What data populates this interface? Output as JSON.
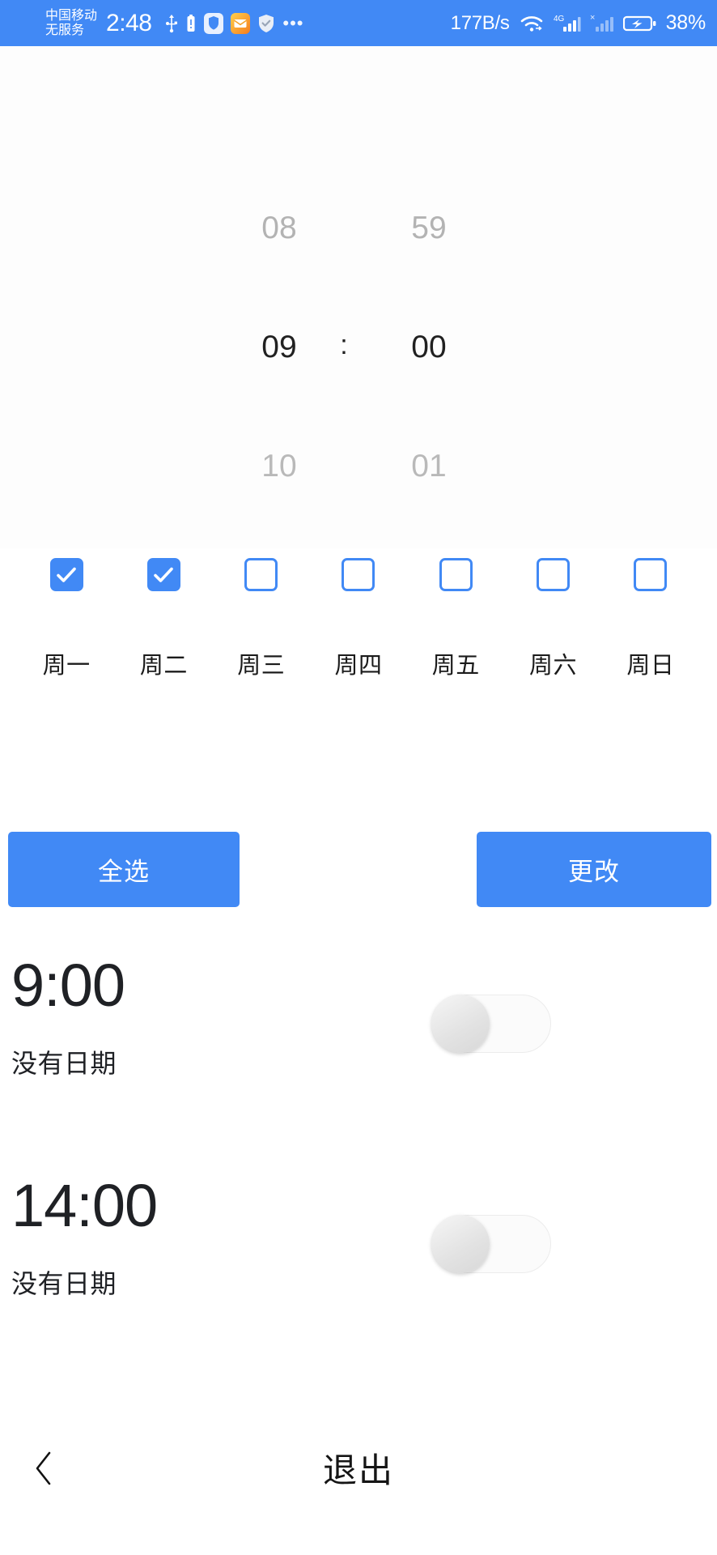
{
  "status_bar": {
    "carrier_line1": "中国移动",
    "carrier_line2": "无服务",
    "time": "2:48",
    "icons": [
      "usb-icon",
      "battery-alert-icon",
      "shield-icon",
      "mail-icon",
      "verified-icon",
      "more-dots-icon"
    ],
    "overflow_dots": "•••",
    "net_speed": "177B/s",
    "right_icons": [
      "wifi-icon",
      "signal-4g-icon",
      "signal-no-service-icon",
      "battery-charging-icon"
    ],
    "signal_label": "4G",
    "no_service_mark": "×",
    "battery_percent": "38%",
    "background_color": "#4189f5",
    "foreground_color": "#ffffff"
  },
  "time_picker": {
    "hour": {
      "prev": "08",
      "selected": "09",
      "next": "10"
    },
    "minute": {
      "prev": "59",
      "selected": "00",
      "next": "01"
    },
    "separator": ":",
    "selected_color": "#212121",
    "dim_color": "#b3b3b3"
  },
  "day_selector": {
    "accent_color": "#4189f5",
    "check_glyph": "✓",
    "days": [
      {
        "label": "周一",
        "checked": true
      },
      {
        "label": "周二",
        "checked": true
      },
      {
        "label": "周三",
        "checked": false
      },
      {
        "label": "周四",
        "checked": false
      },
      {
        "label": "周五",
        "checked": false
      },
      {
        "label": "周六",
        "checked": false
      },
      {
        "label": "周日",
        "checked": false
      }
    ]
  },
  "actions": {
    "select_all_label": "全选",
    "change_label": "更改",
    "button_color": "#4189f5"
  },
  "alarms": [
    {
      "time": "9:00",
      "subtitle": "没有日期",
      "enabled": false
    },
    {
      "time": "14:00",
      "subtitle": "没有日期",
      "enabled": false
    }
  ],
  "bottom_bar": {
    "back_icon": "chevron-left-icon",
    "exit_label": "退出"
  }
}
